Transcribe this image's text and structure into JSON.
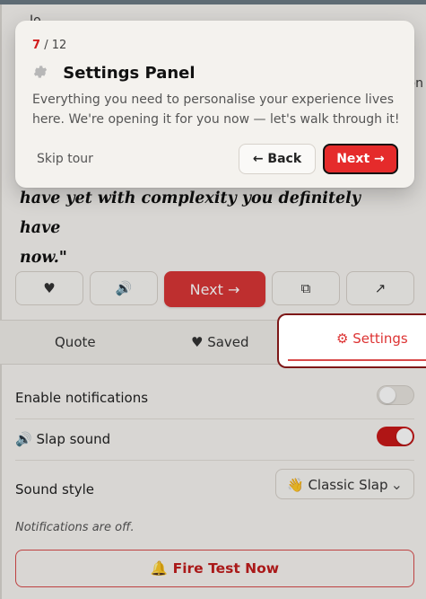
{
  "background_hints": {
    "title_fragment": "Jo",
    "right_fragment": "on"
  },
  "quote": {
    "text_line_1": "have yet with complexity you definitely have",
    "text_line_2": "now.\""
  },
  "action_bar": {
    "favorite_label": "♥",
    "sound_label": "🔊",
    "next_label": "Next →",
    "copy_label": "⧉",
    "share_label": "↗"
  },
  "tabs": {
    "quote_label": "Quote",
    "saved_label": "♥ Saved",
    "settings_label": "⚙ Settings"
  },
  "settings": {
    "notifications_label": "Enable notifications",
    "notifications_enabled": false,
    "slap_sound_label": "🔊 Slap sound",
    "slap_sound_enabled": true,
    "sound_style_label": "Sound style",
    "sound_style_value": "👋 Classic Slap"
  },
  "status": {
    "notifications_off": "Notifications are off."
  },
  "fire_test": {
    "label": "🔔 Fire Test Now"
  },
  "tour": {
    "step_current": "7",
    "step_total": "/ 12",
    "title": "Settings Panel",
    "description": "Everything you need to personalise your experience lives here. We're opening it for you now — let's walk through it!",
    "skip_label": "Skip tour",
    "back_label": "← Back",
    "next_label": "Next →"
  },
  "colors": {
    "accent": "#d93636",
    "accent_dark": "#7d1717",
    "background": "#f6f4f1"
  }
}
